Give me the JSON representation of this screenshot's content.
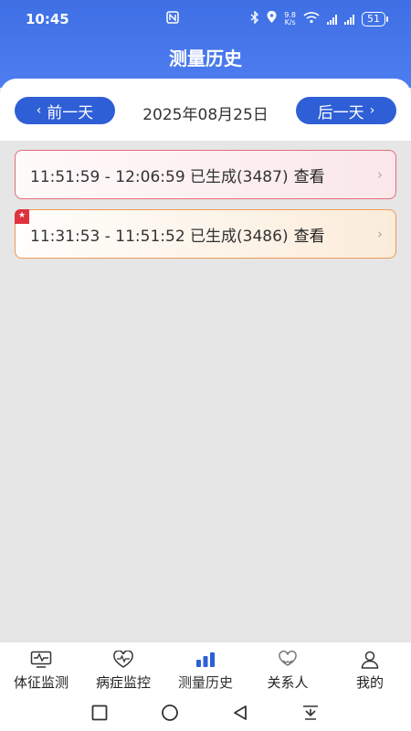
{
  "status_bar": {
    "time": "10:45",
    "net_speed_top": "9.8",
    "net_speed_bottom": "K/s",
    "battery": "51"
  },
  "header": {
    "title": "测量历史"
  },
  "date_nav": {
    "prev_label": "前一天",
    "next_label": "后一天",
    "current_date": "2025年08月25日"
  },
  "records": [
    {
      "range": "11:51:59 - 12:06:59 已生成(3487)",
      "action": "查看",
      "bookmarked": false
    },
    {
      "range": "11:31:53 - 11:51:52 已生成(3486)",
      "action": "查看",
      "bookmarked": true
    }
  ],
  "tabs": [
    {
      "label": "体征监测",
      "icon": "monitor-pulse-icon"
    },
    {
      "label": "病症监控",
      "icon": "heart-pulse-icon"
    },
    {
      "label": "测量历史",
      "icon": "bar-chart-icon",
      "active": true
    },
    {
      "label": "关系人",
      "icon": "heart-hands-icon"
    },
    {
      "label": "我的",
      "icon": "user-icon"
    }
  ],
  "colors": {
    "primary": "#2f5fd6",
    "header_gradient_top": "#3f6fe4",
    "record_red_border": "#e56c7a",
    "record_orange_border": "#ee9a56",
    "bookmark_red": "#e0323e"
  }
}
